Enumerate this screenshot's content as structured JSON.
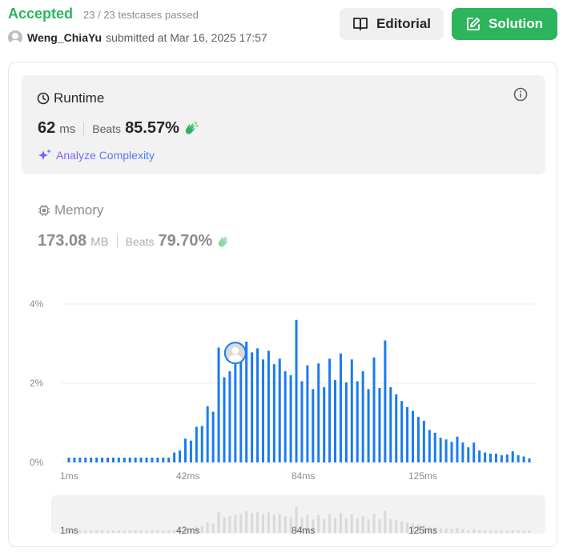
{
  "header": {
    "status": "Accepted",
    "testcases": "23 / 23 testcases passed",
    "username": "Weng_ChiaYu",
    "submitted": "submitted at Mar 16, 2025 17:57",
    "editorial_label": "Editorial",
    "solution_label": "Solution"
  },
  "runtime": {
    "title": "Runtime",
    "value": "62",
    "unit": "ms",
    "beats_label": "Beats",
    "beats_value": "85.57%",
    "analyze_label": "Analyze Complexity"
  },
  "memory": {
    "title": "Memory",
    "value": "173.08",
    "unit": "MB",
    "beats_label": "Beats",
    "beats_value": "79.70%"
  },
  "colors": {
    "accent_green": "#2db55d",
    "bar_blue": "#1a7bf0",
    "nav_bar_gray": "#d9d9d9"
  },
  "chart_data": {
    "type": "bar",
    "ylabel_ticks": [
      "0%",
      "2%",
      "4%"
    ],
    "ylim": [
      0,
      4
    ],
    "x_tick_labels": [
      "1ms",
      "42ms",
      "84ms",
      "125ms"
    ],
    "highlight_index": 30,
    "values": [
      0.12,
      0.12,
      0.12,
      0.12,
      0.12,
      0.12,
      0.12,
      0.12,
      0.12,
      0.12,
      0.12,
      0.12,
      0.12,
      0.12,
      0.12,
      0.12,
      0.12,
      0.12,
      0.12,
      0.25,
      0.3,
      0.6,
      0.55,
      0.9,
      0.92,
      1.42,
      1.28,
      2.9,
      2.15,
      2.3,
      2.48,
      2.6,
      3.05,
      2.78,
      2.88,
      2.6,
      2.82,
      2.48,
      2.62,
      2.3,
      2.2,
      3.6,
      2.05,
      2.45,
      1.85,
      2.5,
      1.9,
      2.62,
      2.08,
      2.75,
      2.02,
      2.6,
      2.05,
      2.3,
      1.85,
      2.65,
      1.88,
      3.08,
      1.9,
      1.72,
      1.55,
      1.4,
      1.3,
      1.15,
      1.05,
      0.82,
      0.75,
      0.62,
      0.58,
      0.52,
      0.65,
      0.5,
      0.38,
      0.5,
      0.3,
      0.25,
      0.22,
      0.22,
      0.18,
      0.2,
      0.28,
      0.18,
      0.15,
      0.1
    ]
  }
}
